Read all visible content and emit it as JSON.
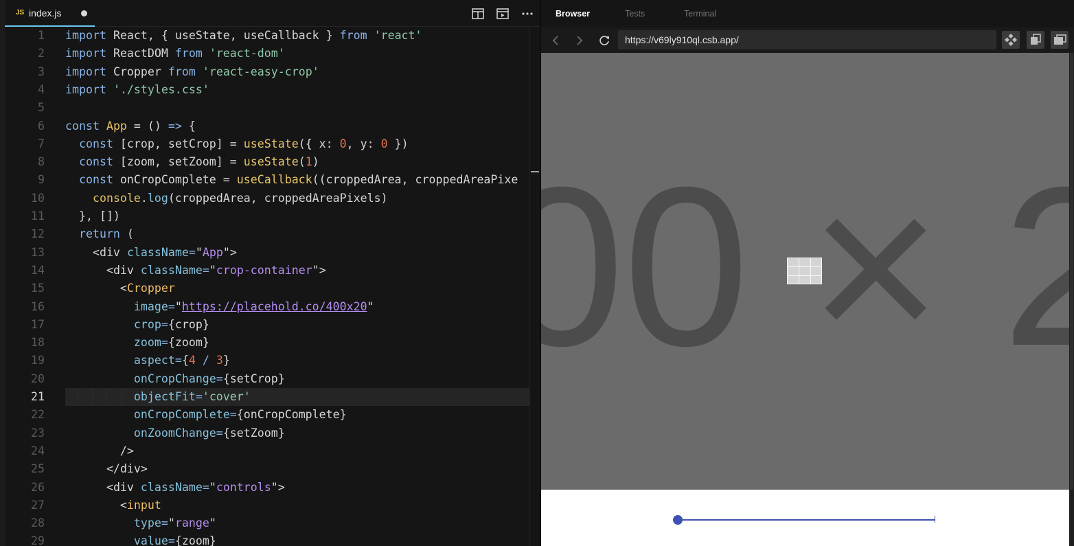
{
  "editor": {
    "tab": {
      "badge": "JS",
      "filename": "index.js"
    },
    "actions": [
      "split-editor-icon",
      "open-preview-icon",
      "more-icon"
    ],
    "active_line": 21,
    "lines": [
      {
        "n": "1",
        "tokens": [
          [
            "kw",
            "import"
          ],
          [
            "id",
            " React, { useState, useCallback } "
          ],
          [
            "kw",
            "from"
          ],
          [
            "id",
            " "
          ],
          [
            "str",
            "'react'"
          ]
        ]
      },
      {
        "n": "2",
        "tokens": [
          [
            "kw",
            "import"
          ],
          [
            "id",
            " ReactDOM "
          ],
          [
            "kw",
            "from"
          ],
          [
            "id",
            " "
          ],
          [
            "str",
            "'react-dom'"
          ]
        ]
      },
      {
        "n": "3",
        "tokens": [
          [
            "kw",
            "import"
          ],
          [
            "id",
            " Cropper "
          ],
          [
            "kw",
            "from"
          ],
          [
            "id",
            " "
          ],
          [
            "str",
            "'react-easy-crop'"
          ]
        ]
      },
      {
        "n": "4",
        "tokens": [
          [
            "kw",
            "import"
          ],
          [
            "id",
            " "
          ],
          [
            "str",
            "'./styles.css'"
          ]
        ]
      },
      {
        "n": "5",
        "tokens": []
      },
      {
        "n": "6",
        "tokens": [
          [
            "kw",
            "const"
          ],
          [
            "id",
            " "
          ],
          [
            "fn",
            "App"
          ],
          [
            "id",
            " = () "
          ],
          [
            "op",
            "=>"
          ],
          [
            "id",
            " {"
          ]
        ]
      },
      {
        "n": "7",
        "tokens": [
          [
            "id",
            "  "
          ],
          [
            "kw",
            "const"
          ],
          [
            "id",
            " [crop, setCrop] = "
          ],
          [
            "fn",
            "useState"
          ],
          [
            "id",
            "({ x: "
          ],
          [
            "num",
            "0"
          ],
          [
            "id",
            ", y: "
          ],
          [
            "num",
            "0"
          ],
          [
            "id",
            " })"
          ]
        ]
      },
      {
        "n": "8",
        "tokens": [
          [
            "id",
            "  "
          ],
          [
            "kw",
            "const"
          ],
          [
            "id",
            " [zoom, setZoom] = "
          ],
          [
            "fn",
            "useState"
          ],
          [
            "id",
            "("
          ],
          [
            "num",
            "1"
          ],
          [
            "id",
            ")"
          ]
        ]
      },
      {
        "n": "9",
        "tokens": [
          [
            "id",
            "  "
          ],
          [
            "kw",
            "const"
          ],
          [
            "id",
            " onCropComplete = "
          ],
          [
            "fn",
            "useCallback"
          ],
          [
            "id",
            "((croppedArea, croppedAreaPixe"
          ]
        ]
      },
      {
        "n": "10",
        "tokens": [
          [
            "id",
            "    "
          ],
          [
            "fn",
            "console"
          ],
          [
            "id",
            "."
          ],
          [
            "attr",
            "log"
          ],
          [
            "id",
            "(croppedArea, croppedAreaPixels)"
          ]
        ]
      },
      {
        "n": "11",
        "tokens": [
          [
            "id",
            "  }, [])"
          ]
        ]
      },
      {
        "n": "12",
        "tokens": [
          [
            "id",
            "  "
          ],
          [
            "kw",
            "return"
          ],
          [
            "id",
            " ("
          ]
        ]
      },
      {
        "n": "13",
        "tokens": [
          [
            "id",
            "    <"
          ],
          [
            "tag",
            "div"
          ],
          [
            "id",
            " "
          ],
          [
            "attr",
            "className"
          ],
          [
            "op",
            "="
          ],
          [
            "id",
            "\""
          ],
          [
            "attrv",
            "App"
          ],
          [
            "id",
            "\">"
          ]
        ]
      },
      {
        "n": "14",
        "tokens": [
          [
            "id",
            "      <"
          ],
          [
            "tag",
            "div"
          ],
          [
            "id",
            " "
          ],
          [
            "attr",
            "className"
          ],
          [
            "op",
            "="
          ],
          [
            "id",
            "\""
          ],
          [
            "attrv",
            "crop-container"
          ],
          [
            "id",
            "\">"
          ]
        ]
      },
      {
        "n": "15",
        "tokens": [
          [
            "id",
            "        <"
          ],
          [
            "comp",
            "Cropper"
          ]
        ]
      },
      {
        "n": "16",
        "tokens": [
          [
            "id",
            "          "
          ],
          [
            "attr",
            "image"
          ],
          [
            "op",
            "="
          ],
          [
            "id",
            "\""
          ],
          [
            "url",
            "https://placehold.co/400x20"
          ],
          [
            "id",
            "\""
          ]
        ]
      },
      {
        "n": "17",
        "tokens": [
          [
            "id",
            "          "
          ],
          [
            "attr",
            "crop"
          ],
          [
            "op",
            "="
          ],
          [
            "id",
            "{crop}"
          ]
        ]
      },
      {
        "n": "18",
        "tokens": [
          [
            "id",
            "          "
          ],
          [
            "attr",
            "zoom"
          ],
          [
            "op",
            "="
          ],
          [
            "id",
            "{zoom}"
          ]
        ]
      },
      {
        "n": "19",
        "tokens": [
          [
            "id",
            "          "
          ],
          [
            "attr",
            "aspect"
          ],
          [
            "op",
            "="
          ],
          [
            "id",
            "{"
          ],
          [
            "num",
            "4"
          ],
          [
            "id",
            " "
          ],
          [
            "op",
            "/"
          ],
          [
            "id",
            " "
          ],
          [
            "num",
            "3"
          ],
          [
            "id",
            "}"
          ]
        ]
      },
      {
        "n": "20",
        "tokens": [
          [
            "id",
            "          "
          ],
          [
            "attr",
            "onCropChange"
          ],
          [
            "op",
            "="
          ],
          [
            "id",
            "{setCrop}"
          ]
        ]
      },
      {
        "n": "21",
        "tokens": [
          [
            "id",
            "          "
          ],
          [
            "attr",
            "objectFit"
          ],
          [
            "op",
            "="
          ],
          [
            "str",
            "'cover'"
          ]
        ]
      },
      {
        "n": "22",
        "tokens": [
          [
            "id",
            "          "
          ],
          [
            "attr",
            "onCropComplete"
          ],
          [
            "op",
            "="
          ],
          [
            "id",
            "{onCropComplete}"
          ]
        ]
      },
      {
        "n": "23",
        "tokens": [
          [
            "id",
            "          "
          ],
          [
            "attr",
            "onZoomChange"
          ],
          [
            "op",
            "="
          ],
          [
            "id",
            "{setZoom}"
          ]
        ]
      },
      {
        "n": "24",
        "tokens": [
          [
            "id",
            "        />"
          ]
        ]
      },
      {
        "n": "25",
        "tokens": [
          [
            "id",
            "      </"
          ],
          [
            "tag",
            "div"
          ],
          [
            "id",
            ">"
          ]
        ]
      },
      {
        "n": "26",
        "tokens": [
          [
            "id",
            "      <"
          ],
          [
            "tag",
            "div"
          ],
          [
            "id",
            " "
          ],
          [
            "attr",
            "className"
          ],
          [
            "op",
            "="
          ],
          [
            "id",
            "\""
          ],
          [
            "attrv",
            "controls"
          ],
          [
            "id",
            "\">"
          ]
        ]
      },
      {
        "n": "27",
        "tokens": [
          [
            "id",
            "        <"
          ],
          [
            "comp",
            "input"
          ]
        ]
      },
      {
        "n": "28",
        "tokens": [
          [
            "id",
            "          "
          ],
          [
            "attr",
            "type"
          ],
          [
            "op",
            "="
          ],
          [
            "id",
            "\""
          ],
          [
            "attrv",
            "range"
          ],
          [
            "id",
            "\""
          ]
        ]
      },
      {
        "n": "29",
        "tokens": [
          [
            "id",
            "          "
          ],
          [
            "attr",
            "value"
          ],
          [
            "op",
            "="
          ],
          [
            "id",
            "{zoom}"
          ]
        ]
      }
    ]
  },
  "browser": {
    "tabs": [
      {
        "label": "Browser",
        "active": true
      },
      {
        "label": "Tests",
        "active": false
      },
      {
        "label": "Terminal",
        "active": false
      }
    ],
    "url": "https://v69ly910ql.csb.app/",
    "nav_icons": [
      "back-icon",
      "forward-icon",
      "refresh-icon"
    ],
    "tool_icons": [
      "devtools-icon",
      "open-new-window-icon",
      "windows-icon"
    ],
    "preview": {
      "placeholder_text": "00 × 2",
      "zoom_slider": {
        "value": 1,
        "min": 1,
        "max": 3,
        "fraction": 0.0
      }
    }
  },
  "colors": {
    "accent": "#3f51b5",
    "editor_bg": "#151515",
    "crop_bg": "#6b6b6b",
    "placeholder_fg": "#4c4c4c"
  }
}
